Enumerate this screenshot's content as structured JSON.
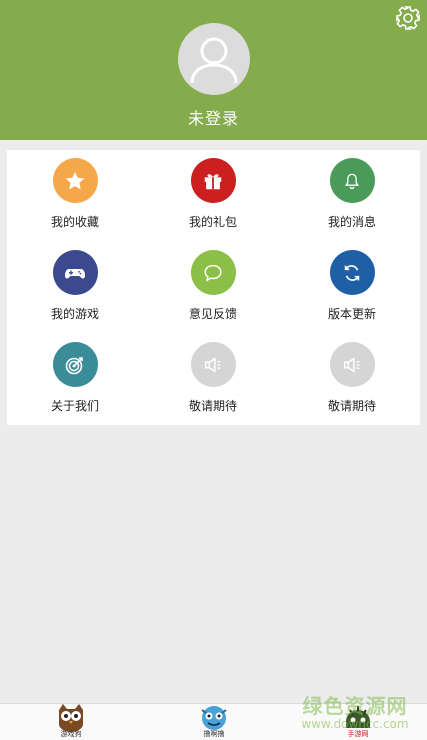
{
  "header": {
    "background_color": "#84ac4c",
    "login_text": "未登录",
    "settings_icon": "gear-icon",
    "avatar_icon": "user-silhouette-icon"
  },
  "menu": {
    "items": [
      {
        "label": "我的收藏",
        "icon": "star-icon",
        "color": "#f5a84a"
      },
      {
        "label": "我的礼包",
        "icon": "gift-icon",
        "color": "#cc1f1f"
      },
      {
        "label": "我的消息",
        "icon": "bell-icon",
        "color": "#4a9a5a"
      },
      {
        "label": "我的游戏",
        "icon": "gamepad-icon",
        "color": "#3b4a8f"
      },
      {
        "label": "意见反馈",
        "icon": "chat-bubble-icon",
        "color": "#8cbf48"
      },
      {
        "label": "版本更新",
        "icon": "refresh-icon",
        "color": "#1f5fa6"
      },
      {
        "label": "关于我们",
        "icon": "target-icon",
        "color": "#3b8c99"
      },
      {
        "label": "敬请期待",
        "icon": "speaker-icon",
        "color": "#d5d5d5"
      },
      {
        "label": "敬请期待",
        "icon": "speaker-icon",
        "color": "#d5d5d5"
      }
    ]
  },
  "tabbar": {
    "tabs": [
      {
        "label": "游戏狗",
        "icon": "owl-mascot-icon"
      },
      {
        "label": "撸啊撸",
        "icon": "blue-mascot-icon"
      },
      {
        "label": "手游网",
        "icon": "green-mascot-icon"
      }
    ]
  },
  "watermark": {
    "text": "绿色资源网",
    "url": "www.downcc.com"
  }
}
